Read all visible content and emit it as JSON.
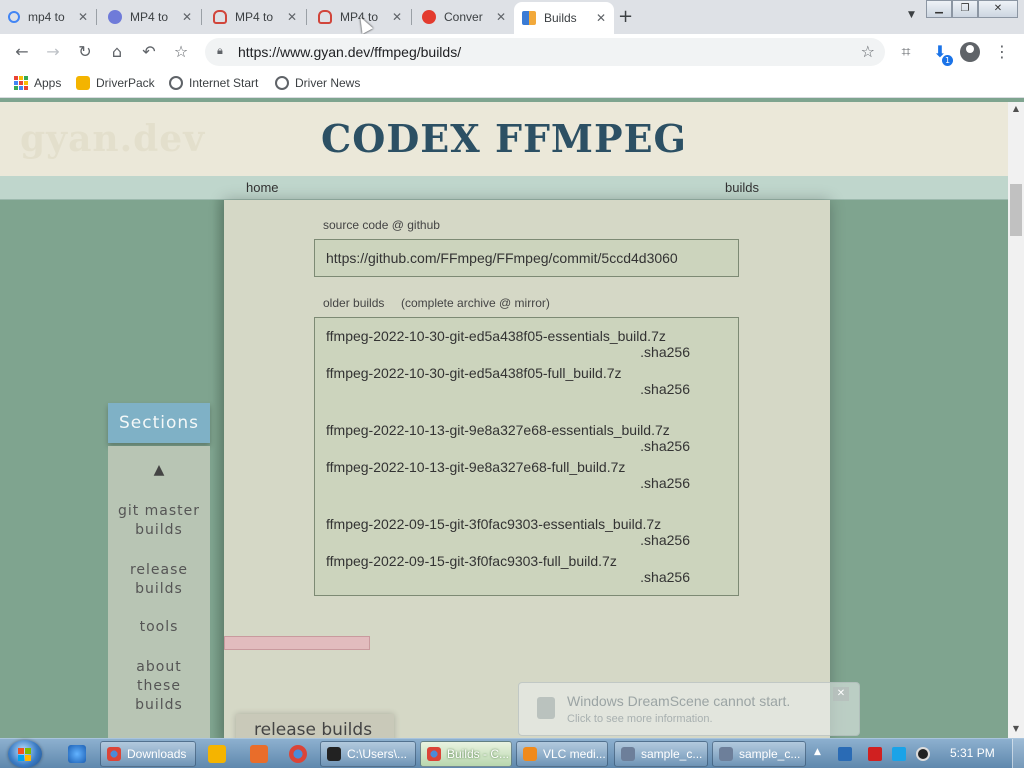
{
  "browser": {
    "tabs": [
      {
        "title": "mp4 to",
        "icon": "search-icon",
        "color": "#4285f4"
      },
      {
        "title": "MP4 to",
        "icon": "converter-icon",
        "color": "#6f7bd9"
      },
      {
        "title": "MP4 to",
        "icon": "cloudconvert-icon",
        "color": "#d1453b"
      },
      {
        "title": "MP4 to",
        "icon": "cloudconvert-icon",
        "color": "#d1453b"
      },
      {
        "title": "Conver",
        "icon": "convertio-icon",
        "color": "#e33b2e"
      },
      {
        "title": "Builds",
        "icon": "gyan-icon",
        "color": "#3a7bd5"
      }
    ],
    "active_tab": 5,
    "url": "https://www.gyan.dev/ffmpeg/builds/",
    "extension_badge": "1",
    "bookmarks": [
      {
        "label": "Apps",
        "icon": "apps-grid-icon"
      },
      {
        "label": "DriverPack",
        "icon": "driverpack-icon"
      },
      {
        "label": "Internet Start",
        "icon": "globe-icon"
      },
      {
        "label": "Driver News",
        "icon": "globe-icon"
      }
    ]
  },
  "site": {
    "ghost_logo": "gyan.dev",
    "title": "CODEX FFMPEG",
    "nav": {
      "home": "home",
      "builds": "builds"
    }
  },
  "content": {
    "source_label": "source code @ github",
    "source_url": "https://github.com/FFmpeg/FFmpeg/commit/5ccd4d3060",
    "older_label": "older builds",
    "archive_label": "(complete archive @ mirror)",
    "sha_label": ".sha256",
    "older_builds": [
      "ffmpeg-2022-10-30-git-ed5a438f05-essentials_build.7z",
      "ffmpeg-2022-10-30-git-ed5a438f05-full_build.7z",
      "ffmpeg-2022-10-13-git-9e8a327e68-essentials_build.7z",
      "ffmpeg-2022-10-13-git-9e8a327e68-full_build.7z",
      "ffmpeg-2022-09-15-git-3f0fac9303-essentials_build.7z",
      "ffmpeg-2022-09-15-git-3f0fac9303-full_build.7z"
    ],
    "release_tab": "release builds"
  },
  "sections": {
    "title": "Sections",
    "up": "▲",
    "items": [
      {
        "l1": "git master",
        "l2": "builds"
      },
      {
        "l1": "release",
        "l2": "builds"
      },
      {
        "l1": "tools",
        "l2": ""
      },
      {
        "l1": "about",
        "l2": "these",
        "l3": "builds"
      }
    ]
  },
  "notification": {
    "title": "Windows DreamScene cannot start.",
    "subtitle": "Click to see more information."
  },
  "taskbar": {
    "tasks": [
      {
        "label": "Downloads",
        "icon": "chrome-icon",
        "color": "#4b8bd8"
      },
      {
        "label": "C:\\Users\\...",
        "icon": "7zip-icon",
        "color": "#222"
      },
      {
        "label": "Builds - C...",
        "icon": "chrome-icon",
        "color": "#4b8bd8"
      },
      {
        "label": "VLC medi...",
        "icon": "vlc-icon",
        "color": "#f08a1c"
      },
      {
        "label": "sample_c...",
        "icon": "video-icon",
        "color": "#6d7f9a"
      },
      {
        "label": "sample_c...",
        "icon": "window-icon",
        "color": "#6d7f9a"
      }
    ],
    "clock": "5:31 PM"
  }
}
